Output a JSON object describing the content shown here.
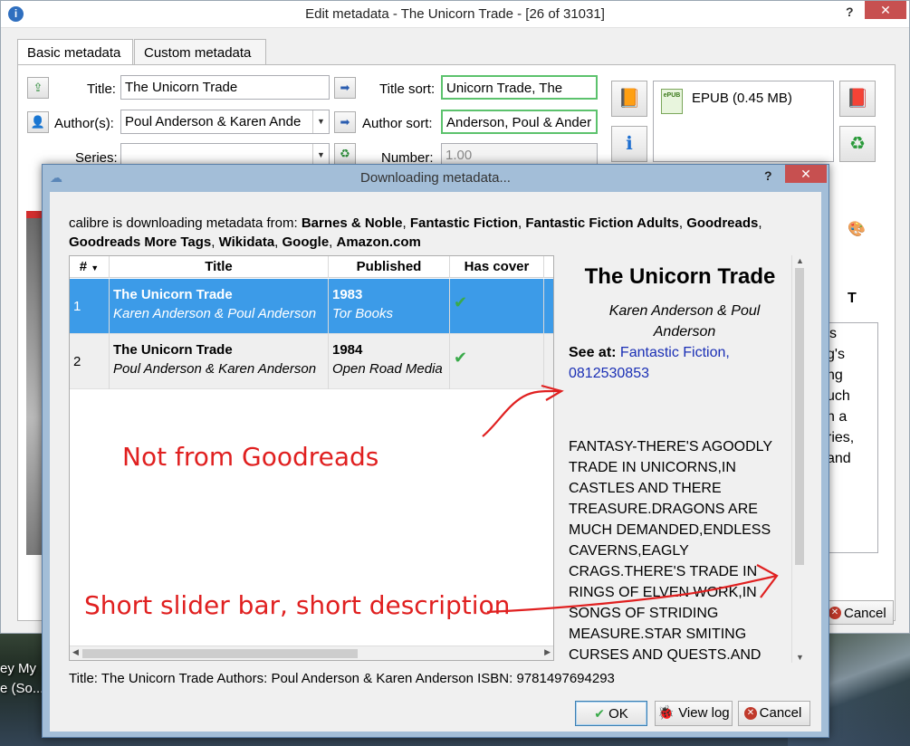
{
  "main_window": {
    "title": "Edit metadata - The Unicorn Trade -  [26 of 31031]",
    "help": "?",
    "close": "✕",
    "tabs": [
      "Basic metadata",
      "Custom metadata"
    ],
    "fields": {
      "title_label": "Title:",
      "title_value": "The Unicorn Trade",
      "author_label": "Author(s):",
      "author_value": "Poul Anderson & Karen Ande",
      "series_label": "Series:",
      "series_value": "",
      "title_sort_label": "Title sort:",
      "title_sort_value": "Unicorn Trade, The",
      "author_sort_label": "Author sort:",
      "author_sort_value": "Anderson, Poul & Ander",
      "number_label": "Number:",
      "number_value": "1.00"
    },
    "format": "EPUB (0.45 MB)",
    "side_text": [
      "'s",
      "g's",
      "ng",
      "uch",
      "n a",
      "ries,",
      "",
      "and"
    ],
    "cancel_label": "Cancel"
  },
  "desktop": {
    "labels": [
      "ey My",
      "e (So..."
    ]
  },
  "dialog": {
    "title": "Downloading metadata...",
    "help": "?",
    "close": "✕",
    "sources_prefix": "calibre is downloading metadata from: ",
    "sources": [
      "Barnes & Noble",
      "Fantastic Fiction",
      "Fantastic Fiction Adults",
      "Goodreads",
      "Goodreads More Tags",
      "Wikidata",
      "Google",
      "Amazon.com"
    ],
    "table": {
      "headers": [
        "#",
        "Title",
        "Published",
        "Has cover"
      ],
      "rows": [
        {
          "num": "1",
          "title": "The Unicorn Trade",
          "authors": "Karen Anderson & Poul Anderson",
          "year": "1983",
          "publisher": "Tor Books",
          "has_cover": true
        },
        {
          "num": "2",
          "title": "The Unicorn Trade",
          "authors": "Poul Anderson & Karen Anderson",
          "year": "1984",
          "publisher": "Open Road Media",
          "has_cover": true
        }
      ]
    },
    "detail": {
      "title": "The Unicorn Trade",
      "authors": "Karen Anderson & Poul Anderson",
      "see_at_label": "See at:",
      "see_at_links": [
        "Fantastic Fiction,",
        "0812530853"
      ],
      "description": "FANTASY-THERE'S AGOODLY TRADE IN UNICORNS,IN CASTLES AND THERE TREASURE.DRAGONS ARE MUCH DEMANDED,ENDLESS CAVERNS,EAGLY CRAGS.THERE'S TRADE IN RINGS OF ELVEN WORK,IN SONGS OF STRIDING MEASURE.STAR SMITING CURSES AND QUESTS.AND"
    },
    "status_line": "Title: The Unicorn Trade Authors: Poul Anderson & Karen Anderson ISBN: 9781497694293",
    "buttons": {
      "ok": "OK",
      "view_log": "View log",
      "cancel": "Cancel"
    }
  },
  "annotations": {
    "not_from_goodreads": "Not from Goodreads",
    "short_slider": "Short slider bar, short description"
  },
  "colors": {
    "selection": "#3c9be8",
    "annotation": "#e02020",
    "link": "#1a2fb5",
    "dialog_frame": "#a3bed8"
  }
}
